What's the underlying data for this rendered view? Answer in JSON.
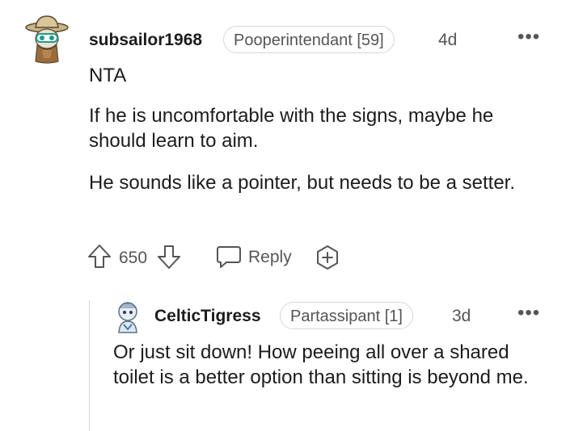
{
  "comment": {
    "username": "subsailor1968",
    "flair": "Pooperintendant [59]",
    "time": "4d",
    "more": "•••",
    "paragraphs": [
      "NTA",
      "If he is uncomfortable with the signs, maybe he should learn to aim.",
      "He sounds like a pointer, but needs to be a setter."
    ],
    "votes": "650",
    "reply_label": "Reply"
  },
  "reply": {
    "username": "CelticTigress",
    "flair": "Partassipant [1]",
    "time": "3d",
    "more": "•••",
    "text": "Or just sit down! How peeing all over a shared toilet is a better option than sitting is beyond me."
  },
  "colors": {
    "text": "#1c1c1c",
    "meta": "#555555",
    "border": "#d4d7d9"
  }
}
